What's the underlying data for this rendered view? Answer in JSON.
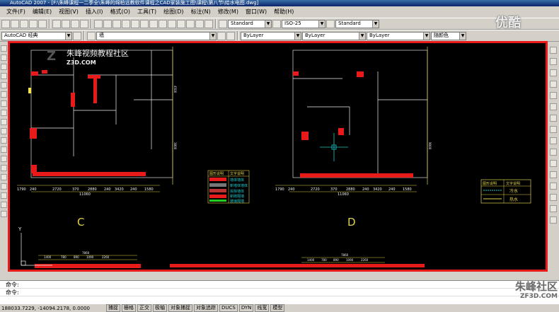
{
  "window": {
    "title": "AutoCAD 2007 - [F:\\朱峰课程一二季全\\朱峰的绵柏远教软件课程之CAD家装施工图\\课程\\第八节\\给水电图.dwg]"
  },
  "menu": {
    "items": [
      "文件(F)",
      "编辑(E)",
      "视图(V)",
      "插入(I)",
      "格式(O)",
      "工具(T)",
      "绘图(D)",
      "标注(N)",
      "修改(M)",
      "窗口(W)",
      "帮助(H)"
    ]
  },
  "toolbar": {
    "text_style": "Standard",
    "dim_style": "ISO-25",
    "table_style": "Standard",
    "workspace": "AutoCAD 经典",
    "layer": "墙",
    "color": "ByLayer",
    "linetype": "ByLayer",
    "lineweight": "ByLayer",
    "plotstyle": "随颜色"
  },
  "watermark": {
    "title": "朱峰视频教程社区",
    "url": "Z3D.COM",
    "site_logo": "朱峰社区",
    "site_url": "ZF3D.COM",
    "player_logo": "优酷"
  },
  "drawing": {
    "label_c": "C",
    "label_d": "D",
    "dims_c": [
      "1790",
      "240",
      "2720",
      "370",
      "2880",
      "240",
      "3420",
      "240",
      "1580"
    ],
    "total_c": "11060",
    "dims_d": [
      "1790",
      "240",
      "2720",
      "370",
      "2880",
      "240",
      "3420",
      "240",
      "1580"
    ],
    "total_d": "11060",
    "bottom_dims": [
      "1400",
      "780",
      "890",
      "1090",
      "2260"
    ],
    "bottom_total": "7860",
    "bottom_dims_d": [
      "1400",
      "780",
      "890",
      "1090",
      "2260"
    ],
    "bottom_total_d": "7860",
    "side_dims": [
      "4500",
      "3800",
      "9000"
    ],
    "legend_c": {
      "title_left": "图形说明",
      "title_right": "文字说明",
      "rows": [
        "墙体墙体",
        "新墙体墙体",
        "拆除墙体",
        "新砌隔墙",
        "玻璃隔墙"
      ]
    },
    "legend_d": {
      "title_left": "图形说明",
      "title_right": "文字说明",
      "rows": [
        "冷水",
        "热水"
      ]
    },
    "ucs_label": "Y"
  },
  "command": {
    "line1": "命令:",
    "line2": "命令:"
  },
  "status": {
    "coords": "188033.7229, -14094.2178, 0.0000",
    "buttons": [
      "捕捉",
      "栅格",
      "正交",
      "极轴",
      "对象捕捉",
      "对象追踪",
      "DUCS",
      "DYN",
      "线宽",
      "模型"
    ]
  }
}
